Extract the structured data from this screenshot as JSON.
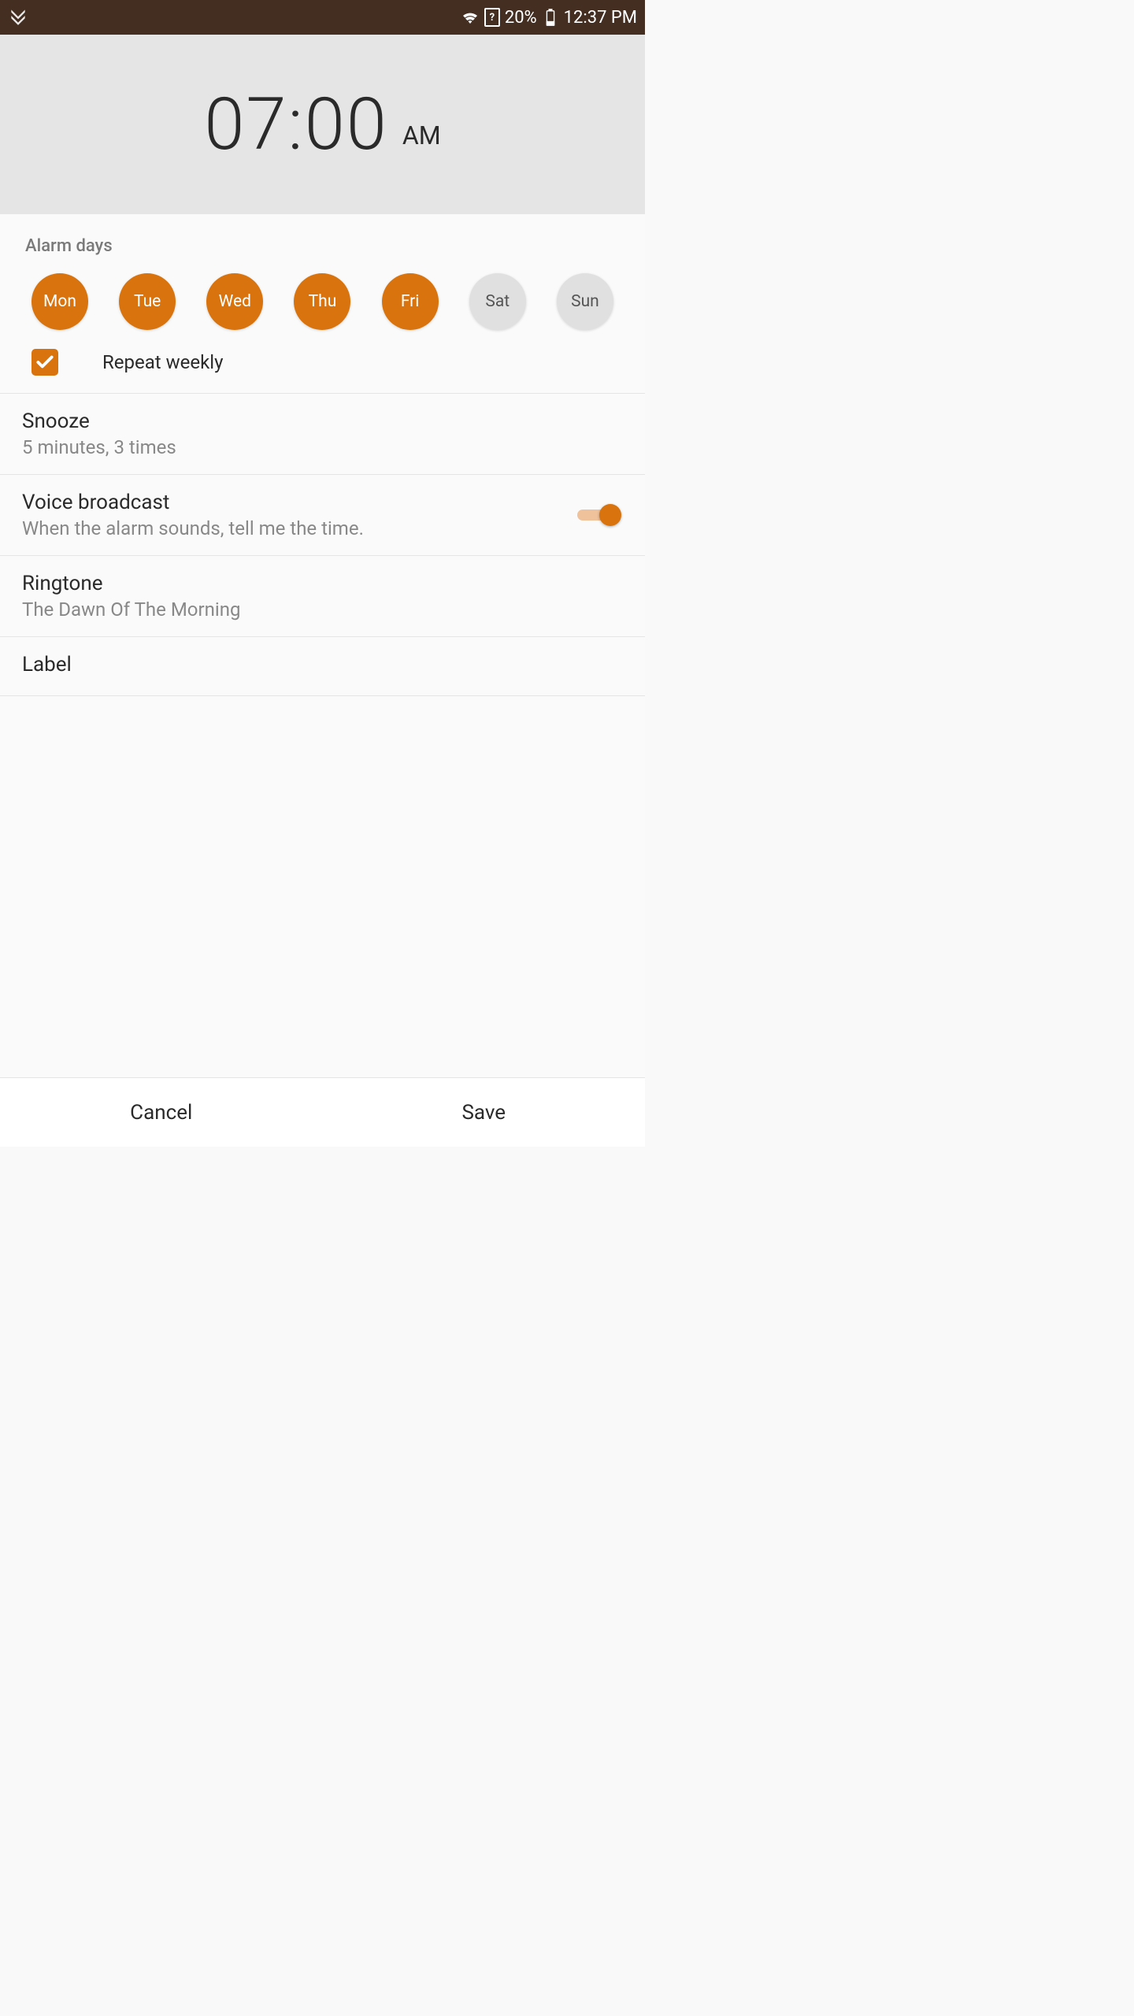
{
  "statusBar": {
    "battery": "20%",
    "time": "12:37 PM"
  },
  "alarm": {
    "time": "07:00",
    "period": "AM"
  },
  "alarmDays": {
    "header": "Alarm days",
    "days": [
      {
        "label": "Mon",
        "active": true
      },
      {
        "label": "Tue",
        "active": true
      },
      {
        "label": "Wed",
        "active": true
      },
      {
        "label": "Thu",
        "active": true
      },
      {
        "label": "Fri",
        "active": true
      },
      {
        "label": "Sat",
        "active": false
      },
      {
        "label": "Sun",
        "active": false
      }
    ],
    "repeat": {
      "checked": true,
      "label": "Repeat weekly"
    }
  },
  "snooze": {
    "title": "Snooze",
    "subtitle": "5 minutes, 3 times"
  },
  "voiceBroadcast": {
    "title": "Voice broadcast",
    "subtitle": "When the alarm sounds, tell me the time.",
    "enabled": true
  },
  "ringtone": {
    "title": "Ringtone",
    "subtitle": "The Dawn Of The Morning"
  },
  "label": {
    "title": "Label"
  },
  "buttons": {
    "cancel": "Cancel",
    "save": "Save"
  }
}
